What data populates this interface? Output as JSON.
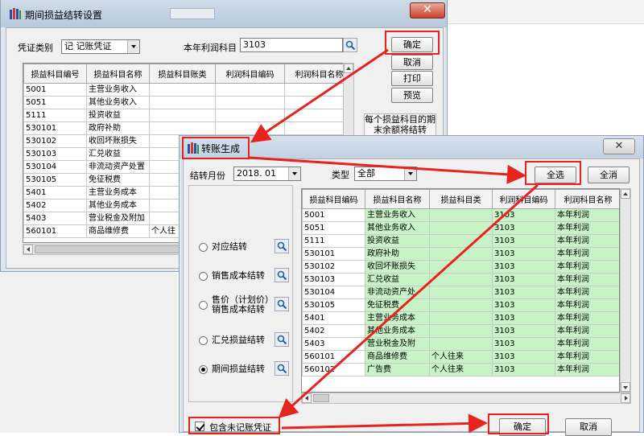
{
  "accent_red": "#e8231e",
  "row_green": "#c8f3c6",
  "window1": {
    "title": "期间损益结转设置",
    "voucher_type_label": "凭证类别",
    "voucher_type_value": "记   记账凭证",
    "profit_account_label": "本年利润科目",
    "profit_account_value": "3103",
    "buttons": {
      "ok": "确定",
      "cancel": "取消",
      "print": "打印",
      "preview": "预览"
    },
    "note": "每个损益科目的期末余额将结转",
    "columns": [
      "损益科目编号",
      "损益科目名称",
      "损益科目账类",
      "利润科目编码",
      "利润科目名称"
    ],
    "rows": [
      [
        "5001",
        "主营业务收入",
        "",
        "",
        ""
      ],
      [
        "5051",
        "其他业务收入",
        "",
        "",
        ""
      ],
      [
        "5111",
        "投资收益",
        "",
        "",
        ""
      ],
      [
        "530101",
        "政府补助",
        "",
        "",
        ""
      ],
      [
        "530102",
        "收回坏账损失",
        "",
        "",
        ""
      ],
      [
        "530103",
        "汇兑收益",
        "",
        "",
        ""
      ],
      [
        "530104",
        "非流动资产处置",
        "",
        "",
        ""
      ],
      [
        "530105",
        "免征税费",
        "",
        "",
        ""
      ],
      [
        "5401",
        "主营业务成本",
        "",
        "",
        ""
      ],
      [
        "5402",
        "其他业务成本",
        "",
        "",
        ""
      ],
      [
        "5403",
        "营业税金及附加",
        "",
        "",
        ""
      ],
      [
        "560101",
        "商品维修费",
        "个人往",
        "",
        ""
      ]
    ]
  },
  "window2": {
    "title": "转账生成",
    "month_label": "结转月份",
    "month_value": "2018. 01",
    "type_label": "类型",
    "type_value": "全部",
    "select_all": "全选",
    "clear_all": "全消",
    "options": [
      {
        "label": "对应结转",
        "selected": false
      },
      {
        "label": "销售成本结转",
        "selected": false
      },
      {
        "label": "售价（计划价）\n销售成本结转",
        "selected": false
      },
      {
        "label": "汇兑损益结转",
        "selected": false
      },
      {
        "label": "期间损益结转",
        "selected": true
      }
    ],
    "columns": [
      "损益科目编码",
      "损益科目名称",
      "损益科目类",
      "利润科目编码",
      "利润科目名称"
    ],
    "rows": [
      [
        "5001",
        "主营业务收入",
        "",
        "3103",
        "本年利润"
      ],
      [
        "5051",
        "其他业务收入",
        "",
        "3103",
        "本年利润"
      ],
      [
        "5111",
        "投资收益",
        "",
        "3103",
        "本年利润"
      ],
      [
        "530101",
        "政府补助",
        "",
        "3103",
        "本年利润"
      ],
      [
        "530102",
        "收回坏账损失",
        "",
        "3103",
        "本年利润"
      ],
      [
        "530103",
        "汇兑收益",
        "",
        "3103",
        "本年利润"
      ],
      [
        "530104",
        "非流动资产处",
        "",
        "3103",
        "本年利润"
      ],
      [
        "530105",
        "免征税费",
        "",
        "3103",
        "本年利润"
      ],
      [
        "5401",
        "主营业务成本",
        "",
        "3103",
        "本年利润"
      ],
      [
        "5402",
        "其他业务成本",
        "",
        "3103",
        "本年利润"
      ],
      [
        "5403",
        "营业税金及附",
        "",
        "3103",
        "本年利润"
      ],
      [
        "560101",
        "商品维修费",
        "个人往来",
        "3103",
        "本年利润"
      ],
      [
        "560102",
        "广告费",
        "个人往来",
        "3103",
        "本年利润"
      ]
    ],
    "checkbox_label": "包含未记账凭证",
    "ok": "确定",
    "cancel": "取消"
  }
}
